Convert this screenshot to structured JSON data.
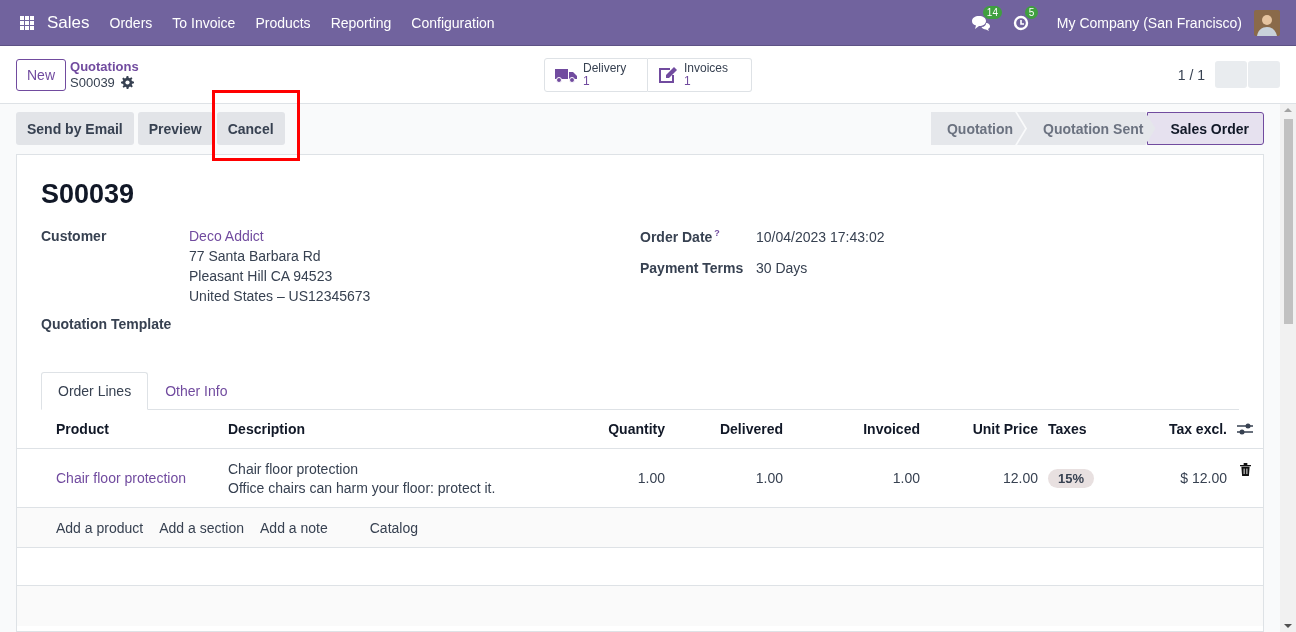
{
  "navbar": {
    "app": "Sales",
    "menu": [
      "Orders",
      "To Invoice",
      "Products",
      "Reporting",
      "Configuration"
    ],
    "messages_badge": "14",
    "activities_badge": "5",
    "company": "My Company (San Francisco)"
  },
  "control_panel": {
    "new_button": "New",
    "breadcrumb": "Quotations",
    "record": "S00039",
    "smart_buttons": [
      {
        "kind": "truck",
        "label": "Delivery",
        "count": "1"
      },
      {
        "kind": "edit",
        "label": "Invoices",
        "count": "1"
      }
    ],
    "pager": "1 / 1"
  },
  "actions": [
    {
      "label": "Send by Email",
      "highlighted": false
    },
    {
      "label": "Preview",
      "highlighted": false
    },
    {
      "label": "Cancel",
      "highlighted": true
    }
  ],
  "statusbar": [
    {
      "label": "Quotation",
      "selected": false
    },
    {
      "label": "Quotation Sent",
      "selected": false
    },
    {
      "label": "Sales Order",
      "selected": true
    }
  ],
  "form": {
    "title": "S00039",
    "left_fields": [
      {
        "label": "Customer",
        "link": "Deco Addict",
        "lines": [
          "77 Santa Barbara Rd",
          "Pleasant Hill CA 94523",
          "United States – US12345673"
        ]
      },
      {
        "label": "Quotation Template"
      }
    ],
    "right_fields": [
      {
        "label": "Order Date",
        "help": "?",
        "value": "10/04/2023 17:43:02"
      },
      {
        "label": "Payment Terms",
        "value": "30 Days"
      }
    ],
    "tabs": [
      {
        "label": "Order Lines",
        "selected": true
      },
      {
        "label": "Other Info",
        "selected": false
      }
    ],
    "table": {
      "columns": [
        "Product",
        "Description",
        "Quantity",
        "Delivered",
        "Invoiced",
        "Unit Price",
        "Taxes",
        "Tax excl."
      ],
      "rows": [
        {
          "product": "Chair floor protection",
          "description": [
            "Chair floor protection",
            "Office chairs can harm your floor: protect it."
          ],
          "quantity": "1.00",
          "delivered": "1.00",
          "invoiced": "1.00",
          "unit_price": "12.00",
          "taxes": "15%",
          "tax_excl": "$ 12.00"
        }
      ],
      "add_links": [
        "Add a product",
        "Add a section",
        "Add a note",
        "Catalog"
      ]
    }
  }
}
